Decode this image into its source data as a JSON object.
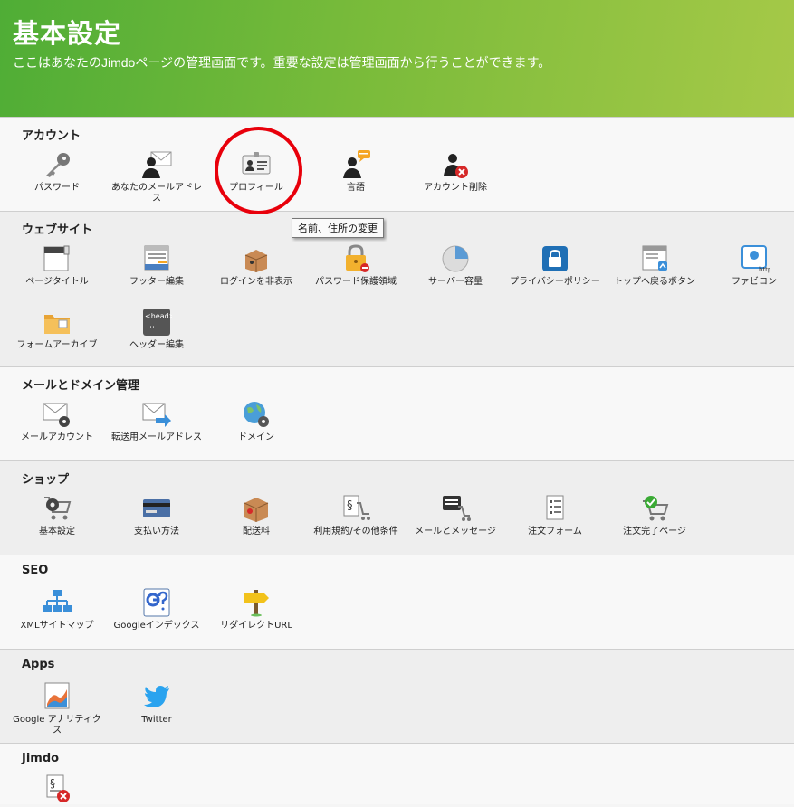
{
  "header": {
    "title": "基本設定",
    "subtitle": "ここはあなたのJimdoページの管理画面です。重要な設定は管理画面から行うことができます。"
  },
  "tooltip": "名前、住所の変更",
  "sections": {
    "account": {
      "title": "アカウント",
      "items": [
        "パスワード",
        "あなたのメールアドレス",
        "プロフィール",
        "言語",
        "アカウント削除"
      ]
    },
    "website": {
      "title": "ウェブサイト",
      "items": [
        "ページタイトル",
        "フッター編集",
        "ログインを非表示",
        "パスワード保護領域",
        "サーバー容量",
        "プライバシーポリシー",
        "トップへ戻るボタン",
        "ファビコン",
        "フォームアーカイブ",
        "ヘッダー編集"
      ]
    },
    "mail": {
      "title": "メールとドメイン管理",
      "items": [
        "メールアカウント",
        "転送用メールアドレス",
        "ドメイン"
      ]
    },
    "shop": {
      "title": "ショップ",
      "items": [
        "基本設定",
        "支払い方法",
        "配送料",
        "利用規約/その他条件",
        "メールとメッセージ",
        "注文フォーム",
        "注文完了ページ"
      ]
    },
    "seo": {
      "title": "SEO",
      "items": [
        "XMLサイトマップ",
        "Googleインデックス",
        "リダイレクトURL"
      ]
    },
    "apps": {
      "title": "Apps",
      "items": [
        "Google アナリティクス",
        "Twitter"
      ]
    },
    "jimdo": {
      "title": "Jimdo"
    }
  },
  "icon_badge_text": {
    "head_tag": "<head>",
    "head_dots": "⋯",
    "favicon_http": "http",
    "section_sign": "§"
  },
  "colors": {
    "header_start": "#4fad36",
    "header_end": "#a6c948",
    "highlight_circle": "#e8000b"
  }
}
